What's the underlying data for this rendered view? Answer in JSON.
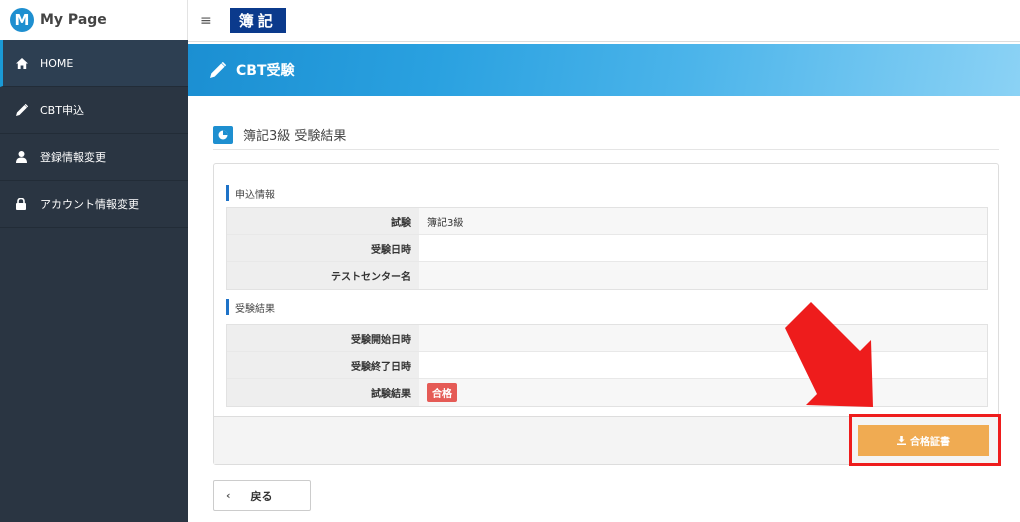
{
  "sidebar": {
    "brand": {
      "logo_letter": "M",
      "title": "My Page"
    },
    "items": [
      {
        "label": "HOME",
        "icon": "home-icon",
        "active": true
      },
      {
        "label": "CBT申込",
        "icon": "pencil-icon"
      },
      {
        "label": "登録情報変更",
        "icon": "user-icon"
      },
      {
        "label": "アカウント情報変更",
        "icon": "lock-icon"
      }
    ]
  },
  "topbar": {
    "menu_icon": "≡",
    "badge": "簿記"
  },
  "banner": {
    "title": "CBT受験"
  },
  "section": {
    "title": "簿記3級 受験結果"
  },
  "application_info": {
    "label": "申込情報",
    "rows": [
      {
        "key": "試験",
        "value": "簿記3級"
      },
      {
        "key": "受験日時",
        "value": ""
      },
      {
        "key": "テストセンター名",
        "value": ""
      }
    ]
  },
  "exam_result": {
    "label": "受験結果",
    "rows": [
      {
        "key": "受験開始日時",
        "value": ""
      },
      {
        "key": "受験終了日時",
        "value": ""
      },
      {
        "key": "試験結果",
        "value": "合格"
      }
    ]
  },
  "actions": {
    "certificate_label": "合格証書",
    "back_label": "戻る"
  },
  "colors": {
    "accent": "#1e8fd0",
    "highlight": "#ee1c1c",
    "certificate_button": "#f0ab52",
    "pass_badge": "#e55b56"
  }
}
